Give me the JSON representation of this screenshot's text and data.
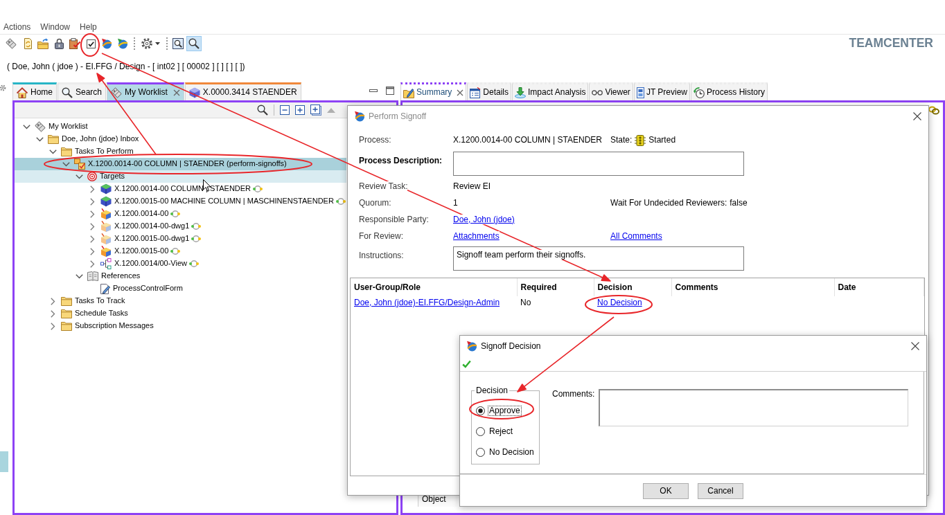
{
  "menu_bar": [
    "Actions",
    "Window",
    "Help"
  ],
  "toolbar": [
    {
      "kind": "tags",
      "pressed": false
    },
    {
      "kind": "document",
      "pressed": false
    },
    {
      "kind": "folder",
      "pressed": false
    },
    {
      "kind": "padlock",
      "pressed": false
    },
    {
      "kind": "clipboard",
      "pressed": false
    },
    {
      "kind": "checkbox",
      "pressed": false
    },
    {
      "kind": "sphere",
      "pressed": false
    },
    {
      "kind": "sphere-alt",
      "pressed": false
    },
    {
      "kind": "separator"
    },
    {
      "kind": "gear-menu",
      "pressed": false
    },
    {
      "kind": "separator"
    },
    {
      "kind": "zoom-frame",
      "pressed": false
    },
    {
      "kind": "magnifier",
      "pressed": true
    }
  ],
  "brand": "TEAMCENTER",
  "session_line": "( Doe, John ( jdoe ) - EI.FFG / Design - [ int02 ] [ 00002 ] [ ] [ ] [ ])",
  "left_panel": {
    "tabs": [
      {
        "label": "Home",
        "selected": false,
        "color": "#27b5c6"
      },
      {
        "label": "Search",
        "selected": false
      },
      {
        "label": "My Worklist",
        "selected": true,
        "color": "#8d42f5"
      },
      {
        "label": "X.0000.3414 STAENDER",
        "selected": false,
        "color": "#f0883a"
      }
    ],
    "tree": [
      {
        "label": "My Worklist",
        "kind": "worklist",
        "expanded": true,
        "selected": false,
        "hovered": false,
        "children": [
          {
            "label": "Doe, John (jdoe) Inbox",
            "kind": "folder",
            "expanded": true,
            "selected": false,
            "hovered": false,
            "children": [
              {
                "label": "Tasks To Perform",
                "kind": "folder",
                "expanded": true,
                "selected": false,
                "hovered": false,
                "children": [
                  {
                    "label": "X.1200.0014-00 COLUMN | STAENDER (perform-signoffs)",
                    "kind": "task",
                    "expanded": true,
                    "selected": true,
                    "hovered": false,
                    "children": [
                      {
                        "label": "Targets",
                        "kind": "targets",
                        "expanded": true,
                        "selected": false,
                        "hovered": true,
                        "children": [
                          {
                            "label": "X.1200.0014-00 COLUMN | STAENDER",
                            "kind": "part",
                            "expanded": false,
                            "selected": false,
                            "hovered": false
                          },
                          {
                            "label": "X.1200.0015-00 MACHINE COLUMN | MASCHINENSTAENDER",
                            "kind": "part",
                            "expanded": false,
                            "selected": false,
                            "hovered": false
                          },
                          {
                            "label": "X.1200.0014-00",
                            "kind": "item",
                            "expanded": false,
                            "selected": false,
                            "hovered": false
                          },
                          {
                            "label": "X.1200.0014-00-dwg1",
                            "kind": "dataset",
                            "expanded": false,
                            "selected": false,
                            "hovered": false
                          },
                          {
                            "label": "X.1200.0015-00-dwg1",
                            "kind": "dataset",
                            "expanded": false,
                            "selected": false,
                            "hovered": false
                          },
                          {
                            "label": "X.1200.0015-00",
                            "kind": "item",
                            "expanded": false,
                            "selected": false,
                            "hovered": false
                          },
                          {
                            "label": "X.1200.0014/00-View",
                            "kind": "view",
                            "expanded": false,
                            "selected": false,
                            "hovered": false
                          }
                        ]
                      },
                      {
                        "label": "References",
                        "kind": "references",
                        "expanded": true,
                        "selected": false,
                        "hovered": false,
                        "children": [
                          {
                            "label": "ProcessControlForm",
                            "kind": "form",
                            "selected": false,
                            "hovered": false
                          }
                        ]
                      }
                    ]
                  }
                ]
              },
              {
                "label": "Tasks To Track",
                "kind": "folder",
                "expanded": false,
                "selected": false,
                "hovered": false
              },
              {
                "label": "Schedule Tasks",
                "kind": "folder",
                "expanded": false,
                "selected": false,
                "hovered": false
              },
              {
                "label": "Subscription Messages",
                "kind": "folder",
                "expanded": false,
                "selected": false,
                "hovered": false
              }
            ]
          }
        ]
      }
    ]
  },
  "right_panel": {
    "tabs": [
      {
        "label": "Summary",
        "selected": true,
        "color": "#8d42f5"
      },
      {
        "label": "Details",
        "selected": false
      },
      {
        "label": "Impact Analysis",
        "selected": false
      },
      {
        "label": "Viewer",
        "selected": false
      },
      {
        "label": "JT Preview",
        "selected": false
      },
      {
        "label": "Process History",
        "selected": false
      }
    ],
    "table": {
      "columns": [
        "Object"
      ]
    }
  },
  "perform_signoff": {
    "title": "Perform Signoff",
    "active": false,
    "fields": [
      {
        "label": "Process:",
        "emphasized": false,
        "kind": "text",
        "value": "X.1200.0014-00 COLUMN | STAENDER",
        "side": {
          "label": "State:",
          "kind": "status",
          "value": "Started"
        }
      },
      {
        "label": "Process Description:",
        "emphasized": true,
        "kind": "textarea"
      },
      {
        "label": "Review Task:",
        "emphasized": false,
        "kind": "text",
        "value": "Review EI"
      },
      {
        "label": "Quorum:",
        "emphasized": false,
        "kind": "text",
        "value": "1",
        "side": {
          "label": "Wait For Undecided Reviewers:",
          "kind": "text",
          "value": "false"
        }
      },
      {
        "label": "Responsible Party:",
        "emphasized": false,
        "kind": "link",
        "value": "Doe, John (jdoe)"
      },
      {
        "label": "For Review:",
        "emphasized": false,
        "kind": "link",
        "value": "Attachments",
        "side": {
          "kind": "link",
          "value": "All Comments"
        }
      },
      {
        "label": "Instructions:",
        "emphasized": false,
        "kind": "textarea",
        "value": "Signoff team perform their signoffs."
      }
    ],
    "table": {
      "columns": [
        "User-Group/Role",
        "Required",
        "Decision",
        "Comments",
        "Date"
      ],
      "rows": [
        {
          "cells": [
            {
              "kind": "link",
              "text": "Doe, John (jdoe)-EI.FFG/Design-Admin"
            },
            {
              "kind": "text",
              "text": "No"
            },
            {
              "kind": "link",
              "text": "No Decision"
            }
          ]
        }
      ]
    }
  },
  "signoff_decision": {
    "title": "Signoff Decision",
    "active": true,
    "group_label": "Decision",
    "options": [
      {
        "label": "Approve",
        "selected": true,
        "focused": true
      },
      {
        "label": "Reject",
        "selected": false,
        "focused": false
      },
      {
        "label": "No Decision",
        "selected": false,
        "focused": false
      }
    ],
    "comments_label": "Comments:",
    "buttons": [
      "OK",
      "Cancel"
    ]
  },
  "annotations": [
    {
      "kind": "ellipse"
    },
    {
      "kind": "ellipse"
    },
    {
      "kind": "ellipse"
    },
    {
      "kind": "ellipse"
    },
    {
      "kind": "arrow"
    },
    {
      "kind": "arrow"
    },
    {
      "kind": "arrow"
    }
  ]
}
